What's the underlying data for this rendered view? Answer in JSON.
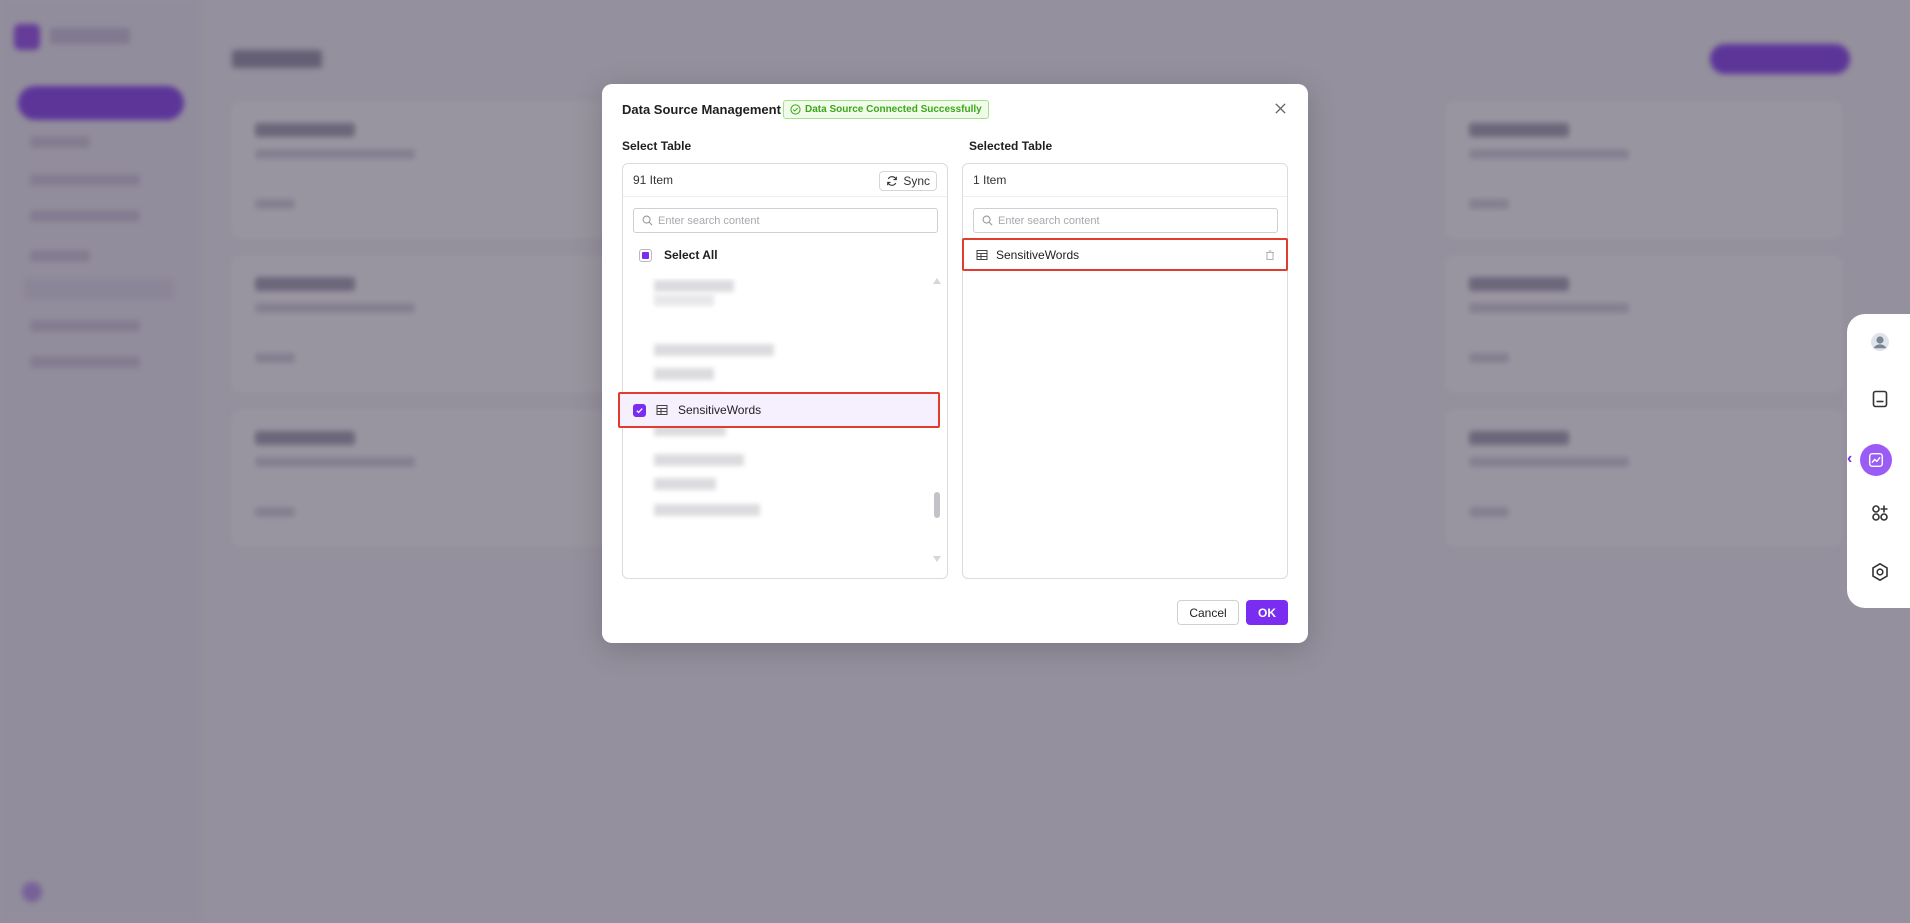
{
  "modal": {
    "title": "Data Source Management",
    "status": "Data Source Connected Successfully",
    "left_panel": {
      "label": "Select Table",
      "count": "91 Item",
      "sync_label": "Sync",
      "search_placeholder": "Enter search content",
      "select_all_label": "Select All",
      "selected_item": "SensitiveWords"
    },
    "right_panel": {
      "label": "Selected Table",
      "count": "1 Item",
      "search_placeholder": "Enter search content",
      "selected_item": "SensitiveWords"
    },
    "cancel_label": "Cancel",
    "ok_label": "OK"
  },
  "toolbar": {
    "icons": [
      "avatar-icon",
      "notebook-icon",
      "chart-icon",
      "apps-icon",
      "settings-icon"
    ],
    "active_icon": "chart-icon",
    "collapse_arrow": "‹"
  },
  "colors": {
    "accent": "#7a2cf0",
    "highlight_border": "#e23c2e",
    "success": "#3aa81a"
  }
}
